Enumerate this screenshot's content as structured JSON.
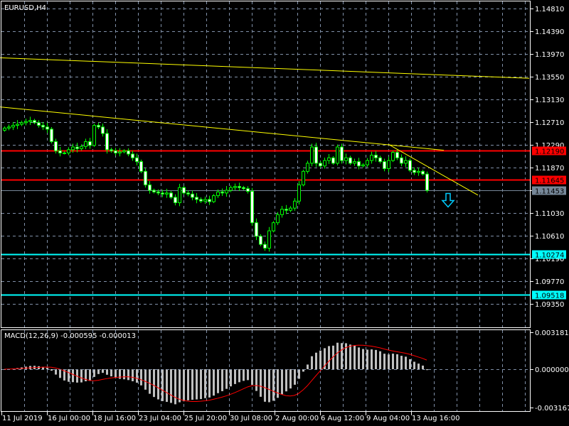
{
  "window": {
    "title": "EURUSD,H4"
  },
  "colors": {
    "background": "#000000",
    "grid": "#8090a8",
    "frame": "#ffffff",
    "candle_outline": "#00ff00",
    "bull_fill": "#000000",
    "bear_fill": "#ffffff",
    "trendline": "#ffff00",
    "resistance": "#ff0000",
    "support": "#00ffff",
    "bid_line": "#778899",
    "macd_hist": "#c0c0c0",
    "macd_signal": "#ff0000"
  },
  "price_axis": {
    "ticks": [
      "1.14810",
      "1.14390",
      "1.13970",
      "1.13550",
      "1.13130",
      "1.12710",
      "1.12290",
      "1.11870",
      "1.11450",
      "1.11030",
      "1.10610",
      "1.10190",
      "1.09770",
      "1.09350"
    ]
  },
  "levels": [
    {
      "name": "resistance-upper",
      "price": 1.1219,
      "label": "1.12190",
      "color": "#ff0000",
      "label_text_color": "#000000"
    },
    {
      "name": "resistance-lower",
      "price": 1.11645,
      "label": "1.11645",
      "color": "#ff0000",
      "label_text_color": "#000000"
    },
    {
      "name": "bid-price",
      "price": 1.11453,
      "label": "1.11453",
      "color": "#778899",
      "label_text_color": "#000000"
    },
    {
      "name": "support-upper",
      "price": 1.10274,
      "label": "1.10274",
      "color": "#00ffff",
      "label_text_color": "#000000"
    },
    {
      "name": "support-lower",
      "price": 1.09518,
      "label": "1.09518",
      "color": "#00ffff",
      "label_text_color": "#000000"
    }
  ],
  "trendlines": [
    {
      "name": "trendline-long",
      "from": [
        -1,
        1.139
      ],
      "to": [
        123,
        1.1352
      ]
    },
    {
      "name": "trendline-mid",
      "from": [
        -1,
        1.1299
      ],
      "to": [
        103,
        1.1219
      ]
    },
    {
      "name": "trendline-short",
      "from": [
        90,
        1.123
      ],
      "to": [
        111,
        1.1136
      ]
    }
  ],
  "signal_arrow": {
    "type": "sell",
    "bar": 104,
    "price": 1.1126
  },
  "time_axis": {
    "labels": [
      "11 Jul 2019",
      "16 Jul 00:00",
      "18 Jul 16:00",
      "23 Jul 04:00",
      "25 Jul 20:00",
      "30 Jul 08:00",
      "2 Aug 00:00",
      "6 Aug 12:00",
      "9 Aug 04:00",
      "13 Aug 16:00"
    ]
  },
  "macd": {
    "label": "MACD(12,26,9) -0.000595 -0.000013",
    "axis": [
      "0.003181",
      "0.000000",
      "-0.003167"
    ],
    "max": 0.003181,
    "min": -0.003167
  },
  "chart_data": {
    "type": "candlestick",
    "symbol": "EURUSD",
    "timeframe": "H4",
    "ylim": [
      1.0915,
      1.15
    ],
    "closes": [
      1.126,
      1.1262,
      1.1265,
      1.1267,
      1.127,
      1.1272,
      1.1274,
      1.127,
      1.1265,
      1.1262,
      1.1258,
      1.1235,
      1.1218,
      1.1214,
      1.1214,
      1.122,
      1.1225,
      1.1222,
      1.1226,
      1.1235,
      1.1228,
      1.1265,
      1.1262,
      1.125,
      1.122,
      1.1218,
      1.1214,
      1.1216,
      1.1218,
      1.1212,
      1.1205,
      1.1198,
      1.118,
      1.1155,
      1.1145,
      1.1142,
      1.114,
      1.1138,
      1.114,
      1.1132,
      1.1122,
      1.115,
      1.114,
      1.1138,
      1.1132,
      1.1128,
      1.1125,
      1.1128,
      1.1124,
      1.1135,
      1.1142,
      1.114,
      1.1145,
      1.115,
      1.1152,
      1.115,
      1.1148,
      1.1143,
      1.1085,
      1.106,
      1.1045,
      1.1038,
      1.107,
      1.1085,
      1.11,
      1.111,
      1.1108,
      1.1112,
      1.1125,
      1.1155,
      1.118,
      1.1195,
      1.1225,
      1.1195,
      1.119,
      1.12,
      1.1205,
      1.1195,
      1.1225,
      1.12,
      1.1205,
      1.1195,
      1.1198,
      1.119,
      1.1192,
      1.12,
      1.121,
      1.1205,
      1.1198,
      1.1185,
      1.12,
      1.1215,
      1.1205,
      1.1195,
      1.12,
      1.1182,
      1.1178,
      1.118,
      1.1175,
      1.1145
    ]
  }
}
